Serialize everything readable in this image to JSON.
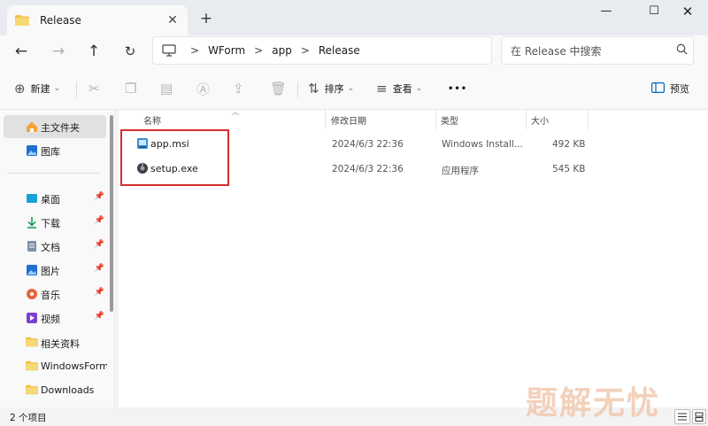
{
  "window": {
    "tab_title": "Release",
    "new_tab": "+",
    "min": "—",
    "max": "☐",
    "close": "✕"
  },
  "nav": {
    "back": "←",
    "forward": "→",
    "up": "↑",
    "refresh": "↻"
  },
  "breadcrumb": [
    "WForm",
    "app",
    "Release"
  ],
  "search": {
    "placeholder": "在 Release 中搜索"
  },
  "toolbar": {
    "new_label": "新建",
    "sort_label": "排序",
    "view_label": "查看",
    "more_label": "•••",
    "preview_label": "预览"
  },
  "sidebar": {
    "items": [
      {
        "label": "主文件夹",
        "icon": "home-icon"
      },
      {
        "label": "图库",
        "icon": "gallery-icon"
      },
      {
        "label": "桌面",
        "icon": "desktop-icon",
        "pinned": true
      },
      {
        "label": "下载",
        "icon": "download-icon",
        "pinned": true
      },
      {
        "label": "文档",
        "icon": "document-icon",
        "pinned": true
      },
      {
        "label": "图片",
        "icon": "pictures-icon",
        "pinned": true
      },
      {
        "label": "音乐",
        "icon": "music-icon",
        "pinned": true
      },
      {
        "label": "视频",
        "icon": "video-icon",
        "pinned": true
      },
      {
        "label": "相关资料",
        "icon": "folder-icon"
      },
      {
        "label": "WindowsForm",
        "icon": "folder-icon"
      },
      {
        "label": "Downloads",
        "icon": "folder-icon"
      }
    ]
  },
  "columns": {
    "name": "名称",
    "modified": "修改日期",
    "type": "类型",
    "size": "大小"
  },
  "files": [
    {
      "name": "app.msi",
      "modified": "2024/6/3 22:36",
      "type": "Windows Install...",
      "size": "492 KB",
      "icon": "msi-icon"
    },
    {
      "name": "setup.exe",
      "modified": "2024/6/3 22:36",
      "type": "应用程序",
      "size": "545 KB",
      "icon": "exe-icon"
    }
  ],
  "status": {
    "count": "2 个项目"
  },
  "watermark": "题解无忧",
  "colors": {
    "highlight": "#d32f2f",
    "folder": "#f2c14e",
    "accent": "#0067c0"
  }
}
